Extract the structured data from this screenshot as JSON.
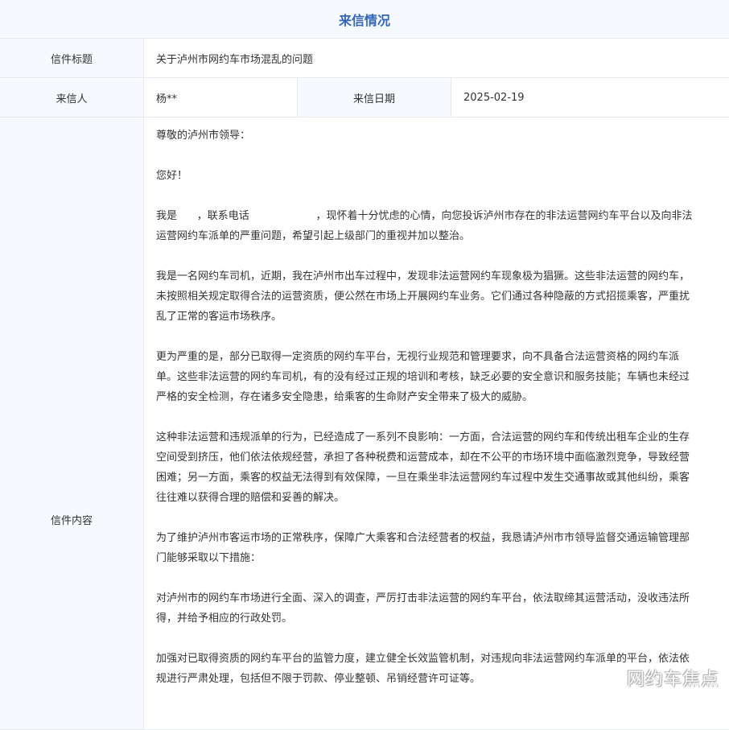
{
  "header": {
    "title": "来信情况"
  },
  "fields": {
    "subject_label": "信件标题",
    "subject_value": "关于泸州市网约车市场混乱的问题",
    "sender_label": "来信人",
    "sender_value": "杨**",
    "date_label": "来信日期",
    "date_value": "2025-02-19",
    "content_label": "信件内容"
  },
  "content": {
    "paragraphs": [
      "尊敬的泸州市领导：",
      "您好！",
      "我是      ，联系电话                    ，现怀着十分忧虑的心情，向您投诉泸州市存在的非法运营网约车平台以及向非法运营网约车派单的严重问题，希望引起上级部门的重视并加以整治。",
      "我是一名网约车司机，近期，我在泸州市出车过程中，发现非法运营网约车现象极为猖獗。这些非法运营的网约车，未按照相关规定取得合法的运营资质，便公然在市场上开展网约车业务。它们通过各种隐蔽的方式招揽乘客，严重扰乱了正常的客运市场秩序。",
      "更为严重的是，部分已取得一定资质的网约车平台，无视行业规范和管理要求，向不具备合法运营资格的网约车派单。这些非法运营的网约车司机，有的没有经过正规的培训和考核，缺乏必要的安全意识和服务技能；车辆也未经过严格的安全检测，存在诸多安全隐患，给乘客的生命财产安全带来了极大的威胁。",
      "这种非法运营和违规派单的行为，已经造成了一系列不良影响：一方面，合法运营的网约车和传统出租车企业的生存空间受到挤压，他们依法依规经营，承担了各种税费和运营成本，却在不公平的市场环境中面临激烈竞争，导致经营困难；另一方面，乘客的权益无法得到有效保障，一旦在乘坐非法运营网约车过程中发生交通事故或其他纠纷，乘客往往难以获得合理的赔偿和妥善的解决。",
      "为了维护泸州市客运市场的正常秩序，保障广大乘客和合法经营者的权益，我恳请泸州市市领导监督交通运输管理部门能够采取以下措施：",
      "对泸州市的网约车市场进行全面、深入的调查，严厉打击非法运营的网约车平台，依法取缔其运营活动，没收违法所得，并给予相应的行政处罚。",
      "加强对已取得资质的网约车平台的监管力度，建立健全长效监管机制，对违规向非法运营网约车派单的平台，依法依规进行严肃处理，包括但不限于罚款、停业整顿、吊销经营许可证等。"
    ]
  },
  "watermark": "网约车焦点"
}
